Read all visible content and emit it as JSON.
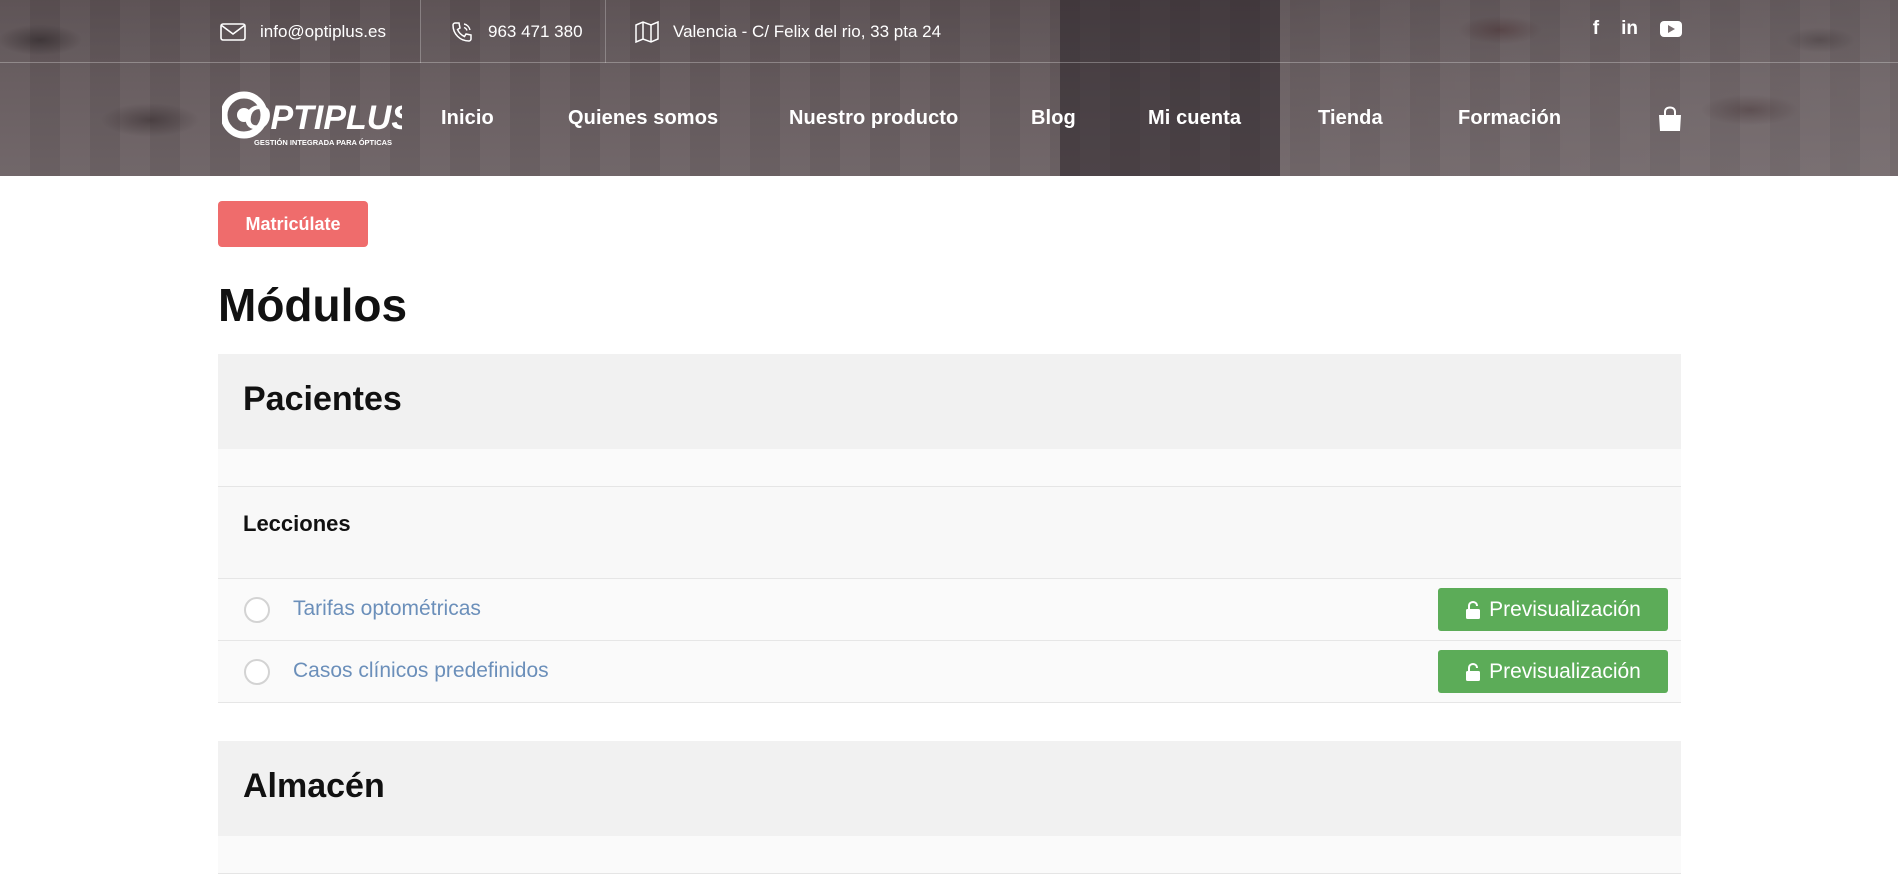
{
  "topbar": {
    "email": "info@optiplus.es",
    "phone": "963 471 380",
    "address": "Valencia - C/ Felix del rio, 33 pta 24",
    "social": [
      {
        "label": "f",
        "icon": "facebook-icon"
      },
      {
        "label": "in",
        "icon": "linkedin-icon"
      },
      {
        "label": "▶",
        "icon": "youtube-icon"
      }
    ]
  },
  "logo": {
    "text": "OPTIPLUS",
    "tagline": "GESTIÓN INTEGRADA PARA ÓPTICAS"
  },
  "nav": {
    "items": [
      "Inicio",
      "Quienes somos",
      "Nuestro producto",
      "Blog",
      "Mi cuenta",
      "Tienda",
      "Formación"
    ]
  },
  "content": {
    "enroll_label": "Matricúlate",
    "modules_title": "Módulos",
    "modules": [
      {
        "title": "Pacientes",
        "lessons_label": "Lecciones",
        "lessons": [
          {
            "title": "Tarifas optométricas",
            "preview_label": "Previsualización"
          },
          {
            "title": "Casos clínicos predefinidos",
            "preview_label": "Previsualización"
          }
        ]
      },
      {
        "title": "Almacén"
      }
    ]
  },
  "colors": {
    "enroll": "#ef6c6c",
    "preview": "#5cac58",
    "lesson_link": "#6b8fba"
  }
}
